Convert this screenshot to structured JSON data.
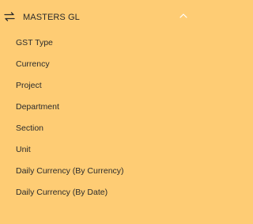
{
  "menu": {
    "title": "MASTERS GL",
    "icons": {
      "toggle": "swap-arrows-icon",
      "collapse": "chevron-up-icon"
    },
    "items": [
      {
        "label": "GST Type"
      },
      {
        "label": "Currency"
      },
      {
        "label": "Project"
      },
      {
        "label": "Department"
      },
      {
        "label": "Section"
      },
      {
        "label": "Unit"
      },
      {
        "label": "Daily Currency (By Currency)"
      },
      {
        "label": "Daily Currency (By Date)"
      }
    ]
  },
  "colors": {
    "background": "#FECC74",
    "text": "#2B2B2B"
  }
}
